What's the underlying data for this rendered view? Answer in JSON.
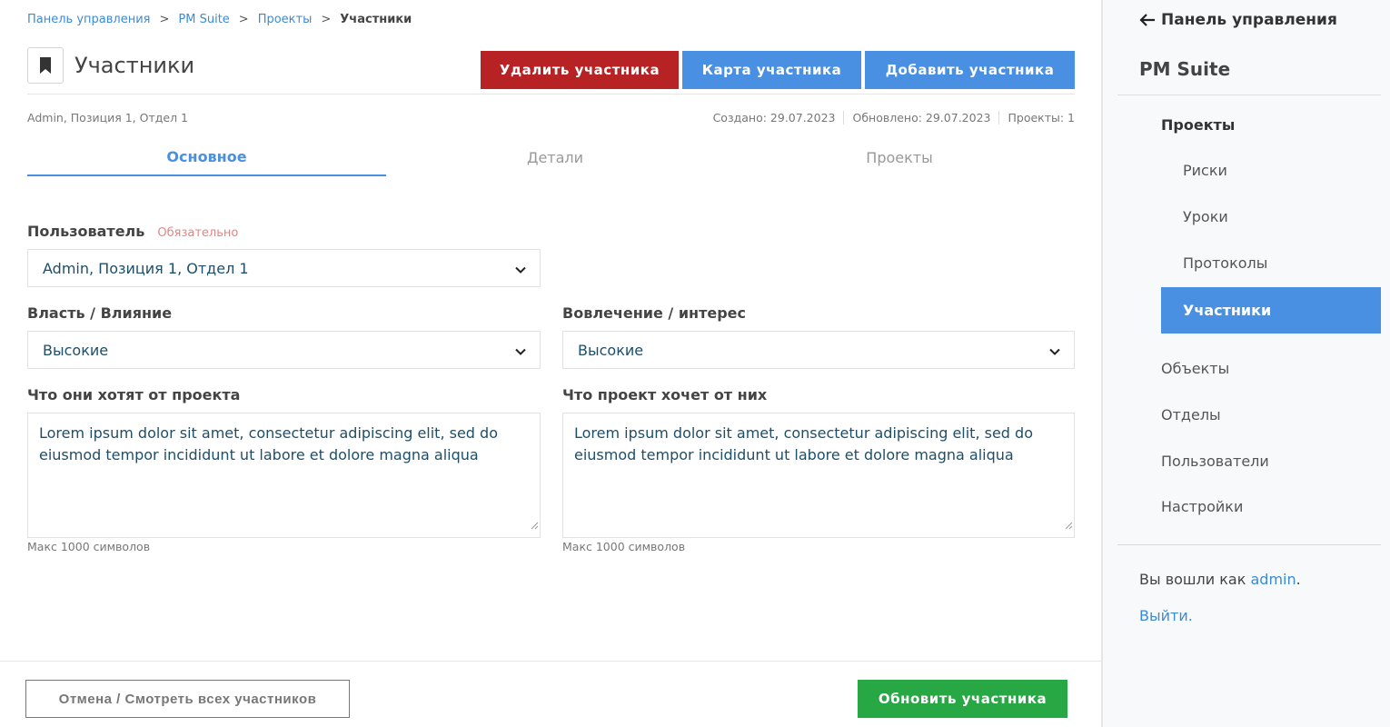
{
  "breadcrumb": {
    "items": [
      "Панель управления",
      "PM Suite",
      "Проекты"
    ],
    "separator": ">",
    "current": "Участники"
  },
  "header": {
    "title": "Участники",
    "icon": "bookmark-icon",
    "buttons": {
      "delete": "Удалить участника",
      "map": "Карта участника",
      "add": "Добавить участника"
    }
  },
  "meta": {
    "summary": "Admin, Позиция 1, Отдел 1",
    "created": "Создано: 29.07.2023",
    "updated": "Обновлено: 29.07.2023",
    "projects": "Проекты: 1"
  },
  "tabs": [
    "Основное",
    "Детали",
    "Проекты"
  ],
  "form": {
    "user": {
      "label": "Пользователь",
      "required": "Обязательно",
      "value": "Admin, Позиция 1, Отдел 1"
    },
    "power": {
      "label": "Власть / Влияние",
      "value": "Высокие"
    },
    "interest": {
      "label": "Вовлечение / интерес",
      "value": "Высокие"
    },
    "want_from_project": {
      "label": "Что они хотят от проекта",
      "value": "Lorem ipsum dolor sit amet, consectetur adipiscing elit, sed do eiusmod tempor incididunt ut labore et dolore magna aliqua",
      "hint": "Макс 1000 символов"
    },
    "project_wants": {
      "label": "Что проект хочет от них",
      "value": "Lorem ipsum dolor sit amet, consectetur adipiscing elit, sed do eiusmod tempor incididunt ut labore et dolore magna aliqua",
      "hint": "Макс 1000 символов"
    }
  },
  "footer": {
    "cancel": "Отмена / Смотреть всех участников",
    "update": "Обновить участника"
  },
  "sidebar": {
    "back": "Панель управления",
    "brand": "PM Suite",
    "items": {
      "projects": "Проекты",
      "risks": "Риски",
      "lessons": "Уроки",
      "protocols": "Протоколы",
      "stakeholders": "Участники",
      "objects": "Объекты",
      "departments": "Отделы",
      "users": "Пользователи",
      "settings": "Настройки"
    },
    "logged_prefix": "Вы вошли как",
    "username": "admin",
    "logged_suffix": ".",
    "logout": "Выйти."
  },
  "colors": {
    "primary": "#4a90e2",
    "danger": "#b72325",
    "success": "#28a745"
  }
}
